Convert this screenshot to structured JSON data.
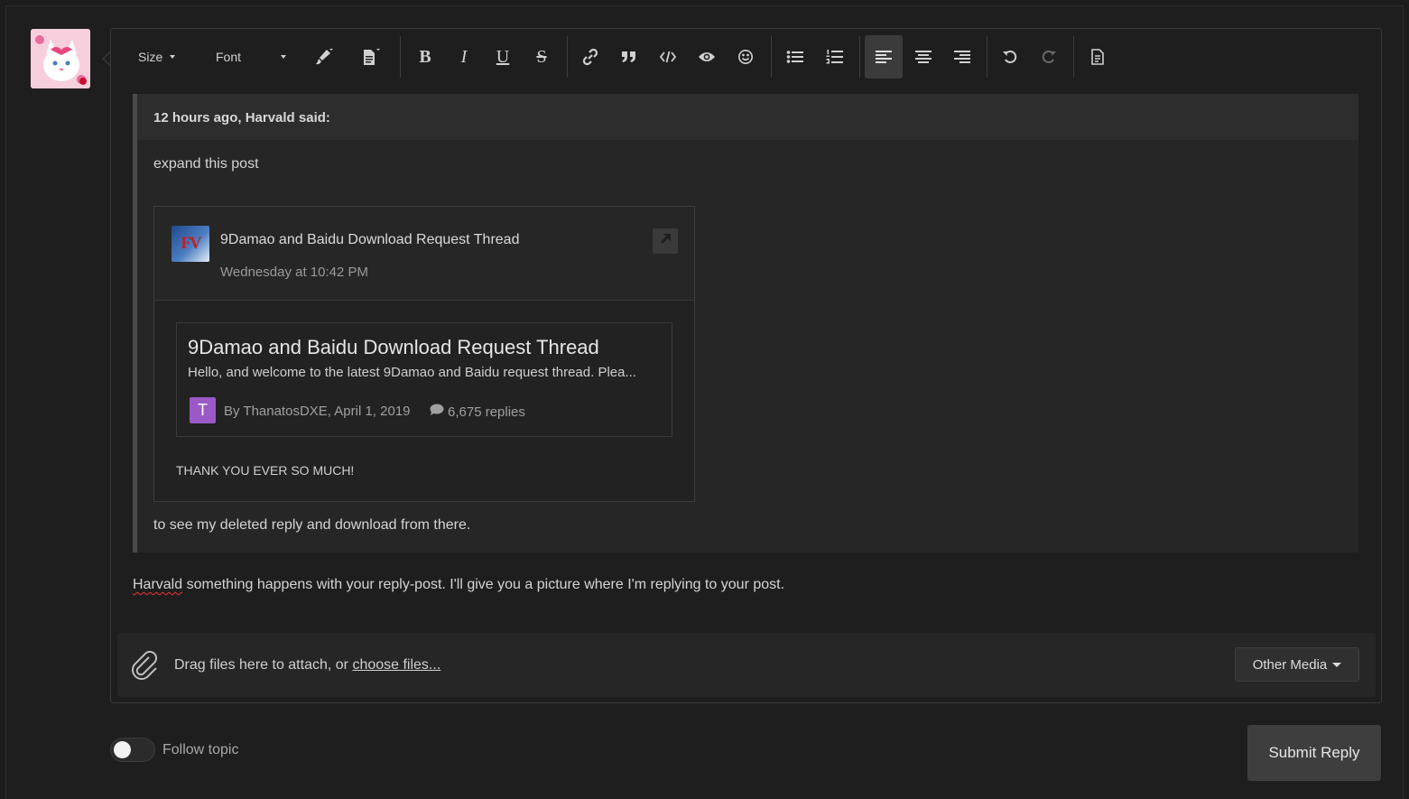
{
  "toolbar": {
    "size_label": "Size",
    "font_label": "Font",
    "icons": [
      "paintbrush-icon",
      "source-file-icon",
      "bold-icon",
      "italic-icon",
      "underline-icon",
      "strikethrough-icon",
      "link-icon",
      "quote-icon",
      "code-icon",
      "spoiler-eye-icon",
      "emoji-icon",
      "bullet-list-icon",
      "numbered-list-icon",
      "align-left-icon",
      "align-center-icon",
      "align-right-icon",
      "undo-icon",
      "redo-icon",
      "preview-document-icon"
    ],
    "bold_glyph": "B",
    "italic_glyph": "I",
    "underline_glyph": "U",
    "strike_glyph": "S"
  },
  "quote": {
    "header": "12 hours ago, Harvald said:",
    "first_line": "expand this post",
    "last_line": "to see my deleted reply and download from there."
  },
  "embed": {
    "icon_text": "FV",
    "title": "9Damao and Baidu Download Request Thread",
    "date": "Wednesday at 10:42 PM",
    "card": {
      "title": "9Damao and Baidu Download Request Thread",
      "description": "Hello, and welcome to the latest 9Damao and Baidu request thread.   Plea...",
      "avatar_letter": "T",
      "meta": "By ThanatosDXE, April 1, 2019",
      "replies": "6,675 replies"
    },
    "note": "THANK YOU EVER SO MUCH!"
  },
  "body": {
    "misspelled": "Harvald",
    "text": " something happens with your reply-post. I'll give you a picture where I'm replying to your post."
  },
  "attach": {
    "prefix": "Drag files here to attach, or ",
    "link": "choose files...",
    "other_media": "Other Media"
  },
  "footer": {
    "follow_label": "Follow topic",
    "follow_on": false,
    "submit_label": "Submit Reply"
  },
  "colors": {
    "background": "#1c1c1c",
    "panel": "#262626",
    "accent_avatar": "#9b59c7"
  }
}
